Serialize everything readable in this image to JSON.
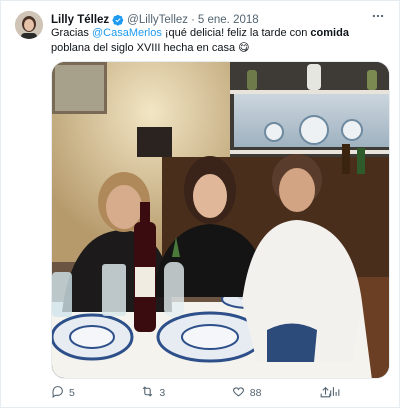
{
  "author": {
    "name": "Lilly Téllez",
    "handle": "@LillyTellez",
    "separator": "·",
    "date": "5 ene. 2018"
  },
  "tweet": {
    "text_part1": "Gracias ",
    "mention": "@CasaMerlos",
    "text_part2": " ¡qué delicia! feliz la tarde con ",
    "bold_word": "comida",
    "text_part3": " poblana del siglo XVIII hecha en casa ",
    "emoji": "😋"
  },
  "actions": {
    "replies": "5",
    "retweets": "3",
    "likes": "88"
  },
  "icons": [
    "verified-icon",
    "more-icon",
    "reply-icon",
    "retweet-icon",
    "like-icon",
    "views-icon",
    "share-icon"
  ],
  "colors": {
    "accent": "#1d9bf0",
    "text": "#0f1419",
    "muted": "#536471"
  }
}
